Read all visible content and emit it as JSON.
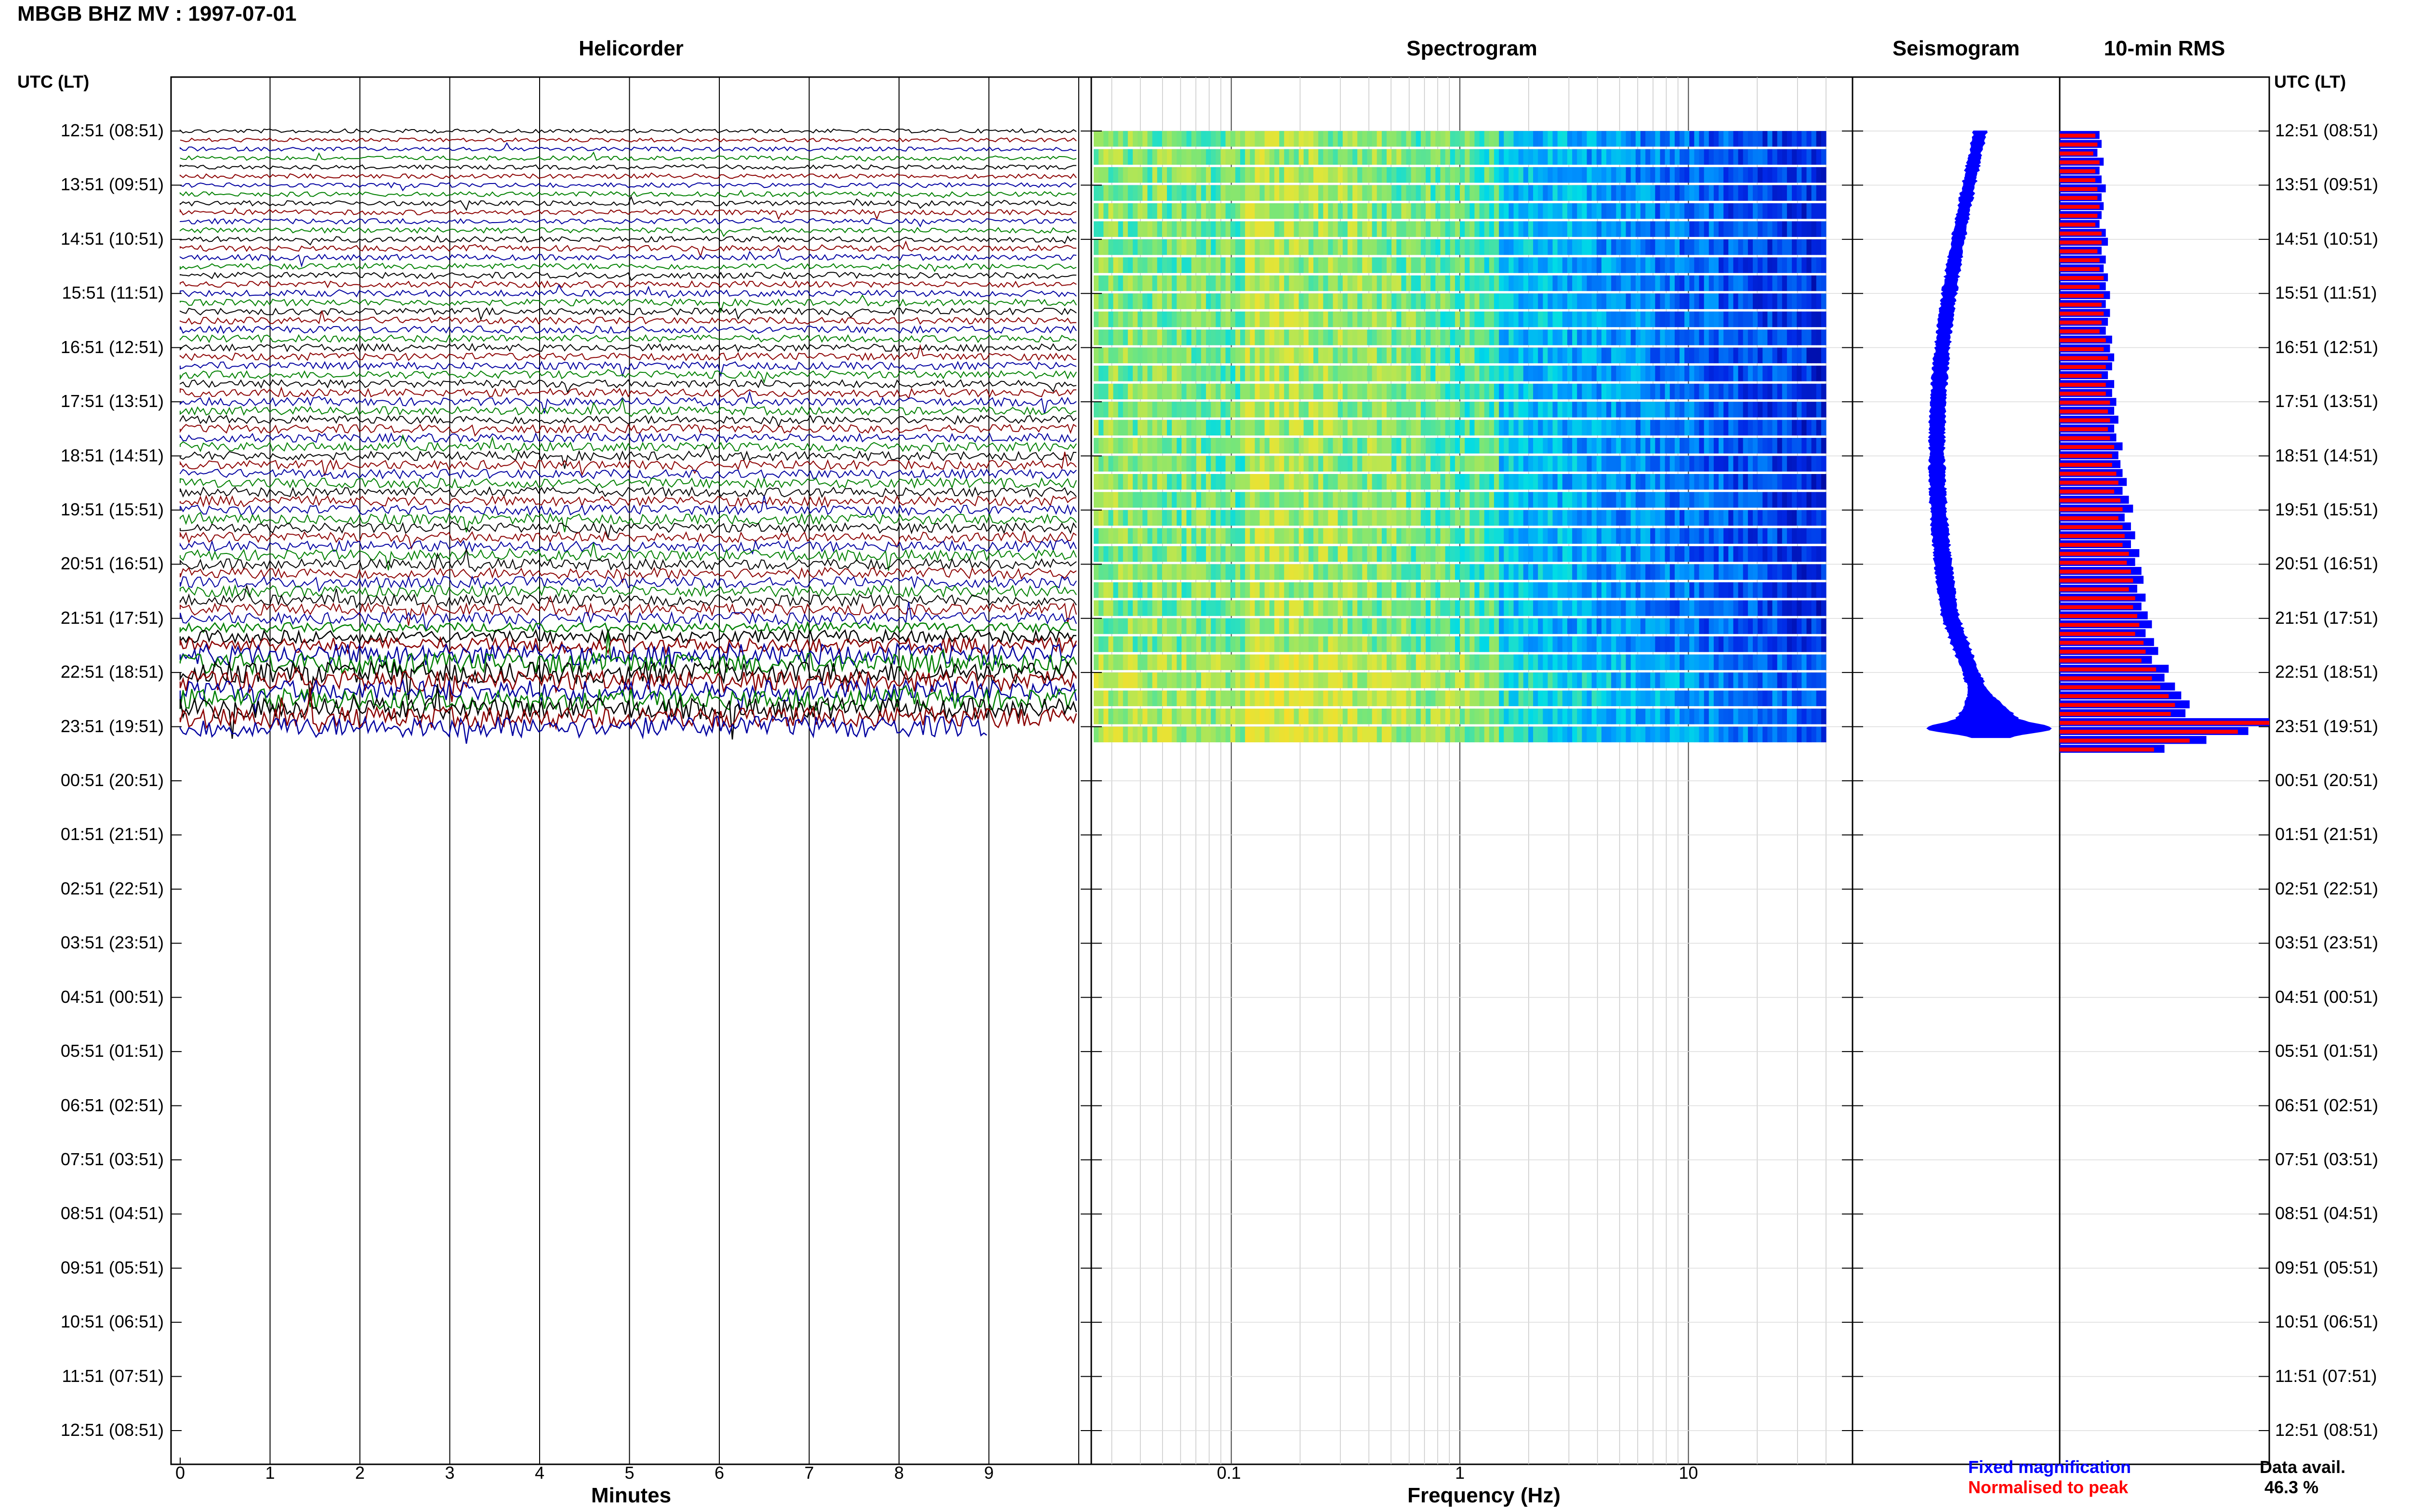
{
  "header": {
    "station_title": "MBGB BHZ MV : 1997-07-01"
  },
  "panels": {
    "helicorder_title": "Helicorder",
    "spectrogram_title": "Spectrogram",
    "seismogram_title": "Seismogram",
    "rms_title": "10-min RMS"
  },
  "axes": {
    "left_header": "UTC (LT)",
    "right_header": "UTC (LT)",
    "time_labels": [
      "12:51 (08:51)",
      "13:51 (09:51)",
      "14:51 (10:51)",
      "15:51 (11:51)",
      "16:51 (12:51)",
      "17:51 (13:51)",
      "18:51 (14:51)",
      "19:51 (15:51)",
      "20:51 (16:51)",
      "21:51 (17:51)",
      "22:51 (18:51)",
      "23:51 (19:51)",
      "00:51 (20:51)",
      "01:51 (21:51)",
      "02:51 (22:51)",
      "03:51 (23:51)",
      "04:51 (00:51)",
      "05:51 (01:51)",
      "06:51 (02:51)",
      "07:51 (03:51)",
      "08:51 (04:51)",
      "09:51 (05:51)",
      "10:51 (06:51)",
      "11:51 (07:51)",
      "12:51 (08:51)"
    ],
    "minutes_label": "Minutes",
    "minutes_ticks": [
      "0",
      "1",
      "2",
      "3",
      "4",
      "5",
      "6",
      "7",
      "8",
      "9"
    ],
    "frequency_label": "Frequency (Hz)",
    "frequency_ticks": [
      "0.1",
      "1",
      "10"
    ]
  },
  "legend": {
    "fixed": "Fixed magnification",
    "normalised": "Normalised to peak",
    "fixed_color": "#0000ff",
    "normalised_color": "#ff0000"
  },
  "availability": {
    "label": "Data avail.",
    "value": "46.3 %"
  },
  "chart_data": {
    "type": "helicorder",
    "date": "1997-07-01",
    "trace_colors": [
      "#000000",
      "#8b0000",
      "#0000a0",
      "#008000"
    ],
    "lines_per_hour": 6,
    "data_rows": 67,
    "last_row_minutes": 9,
    "frequency_range_hz": [
      0.025,
      40
    ],
    "rms_rows": [
      {
        "fixed": 0.19,
        "norm": 0.17
      },
      {
        "fixed": 0.2,
        "norm": 0.18
      },
      {
        "fixed": 0.18,
        "norm": 0.16
      },
      {
        "fixed": 0.21,
        "norm": 0.19
      },
      {
        "fixed": 0.19,
        "norm": 0.17
      },
      {
        "fixed": 0.2,
        "norm": 0.17
      },
      {
        "fixed": 0.22,
        "norm": 0.18
      },
      {
        "fixed": 0.2,
        "norm": 0.18
      },
      {
        "fixed": 0.21,
        "norm": 0.19
      },
      {
        "fixed": 0.2,
        "norm": 0.18
      },
      {
        "fixed": 0.19,
        "norm": 0.17
      },
      {
        "fixed": 0.22,
        "norm": 0.2
      },
      {
        "fixed": 0.23,
        "norm": 0.2
      },
      {
        "fixed": 0.2,
        "norm": 0.18
      },
      {
        "fixed": 0.22,
        "norm": 0.19
      },
      {
        "fixed": 0.21,
        "norm": 0.19
      },
      {
        "fixed": 0.23,
        "norm": 0.21
      },
      {
        "fixed": 0.22,
        "norm": 0.19
      },
      {
        "fixed": 0.24,
        "norm": 0.21
      },
      {
        "fixed": 0.22,
        "norm": 0.2
      },
      {
        "fixed": 0.24,
        "norm": 0.21
      },
      {
        "fixed": 0.23,
        "norm": 0.2
      },
      {
        "fixed": 0.22,
        "norm": 0.19
      },
      {
        "fixed": 0.25,
        "norm": 0.22
      },
      {
        "fixed": 0.24,
        "norm": 0.21
      },
      {
        "fixed": 0.26,
        "norm": 0.23
      },
      {
        "fixed": 0.25,
        "norm": 0.22
      },
      {
        "fixed": 0.23,
        "norm": 0.2
      },
      {
        "fixed": 0.26,
        "norm": 0.22
      },
      {
        "fixed": 0.25,
        "norm": 0.22
      },
      {
        "fixed": 0.27,
        "norm": 0.24
      },
      {
        "fixed": 0.26,
        "norm": 0.23
      },
      {
        "fixed": 0.28,
        "norm": 0.24
      },
      {
        "fixed": 0.26,
        "norm": 0.23
      },
      {
        "fixed": 0.27,
        "norm": 0.24
      },
      {
        "fixed": 0.3,
        "norm": 0.26
      },
      {
        "fixed": 0.28,
        "norm": 0.25
      },
      {
        "fixed": 0.29,
        "norm": 0.25
      },
      {
        "fixed": 0.3,
        "norm": 0.27
      },
      {
        "fixed": 0.32,
        "norm": 0.28
      },
      {
        "fixed": 0.3,
        "norm": 0.26
      },
      {
        "fixed": 0.33,
        "norm": 0.29
      },
      {
        "fixed": 0.35,
        "norm": 0.3
      },
      {
        "fixed": 0.31,
        "norm": 0.28
      },
      {
        "fixed": 0.34,
        "norm": 0.3
      },
      {
        "fixed": 0.36,
        "norm": 0.31
      },
      {
        "fixed": 0.34,
        "norm": 0.3
      },
      {
        "fixed": 0.38,
        "norm": 0.33
      },
      {
        "fixed": 0.36,
        "norm": 0.32
      },
      {
        "fixed": 0.39,
        "norm": 0.34
      },
      {
        "fixed": 0.4,
        "norm": 0.35
      },
      {
        "fixed": 0.37,
        "norm": 0.33
      },
      {
        "fixed": 0.41,
        "norm": 0.36
      },
      {
        "fixed": 0.39,
        "norm": 0.35
      },
      {
        "fixed": 0.42,
        "norm": 0.37
      },
      {
        "fixed": 0.44,
        "norm": 0.38
      },
      {
        "fixed": 0.41,
        "norm": 0.36
      },
      {
        "fixed": 0.45,
        "norm": 0.4
      },
      {
        "fixed": 0.47,
        "norm": 0.41
      },
      {
        "fixed": 0.44,
        "norm": 0.39
      },
      {
        "fixed": 0.52,
        "norm": 0.46
      },
      {
        "fixed": 0.5,
        "norm": 0.44
      },
      {
        "fixed": 0.55,
        "norm": 0.48
      },
      {
        "fixed": 0.58,
        "norm": 0.52
      },
      {
        "fixed": 0.62,
        "norm": 0.55
      },
      {
        "fixed": 0.6,
        "norm": 0.53
      },
      {
        "fixed": 1.0,
        "norm": 1.0
      },
      {
        "fixed": 0.9,
        "norm": 0.85
      },
      {
        "fixed": 0.7,
        "norm": 0.62
      },
      {
        "fixed": 0.5,
        "norm": 0.45
      }
    ]
  }
}
